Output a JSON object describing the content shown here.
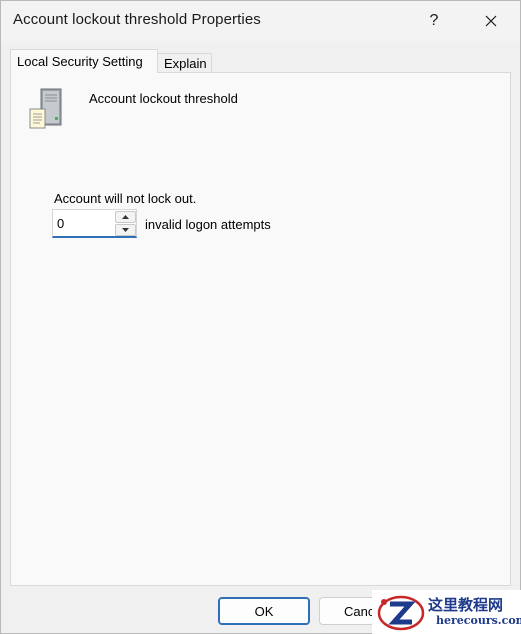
{
  "window": {
    "title": "Account lockout threshold Properties",
    "help_label": "?",
    "close_label": "✕"
  },
  "tabs": [
    {
      "label": "Local Security Setting",
      "active": true
    },
    {
      "label": "Explain",
      "active": false
    }
  ],
  "setting": {
    "icon": "server-icon",
    "policy_name": "Account lockout threshold",
    "status_text": "Account will not lock out.",
    "value": "0",
    "unit_label": "invalid logon attempts"
  },
  "buttons": {
    "ok_label": "OK",
    "cancel_label": "Canc"
  },
  "watermark": {
    "title": "这里教程网",
    "url": "herecours.com"
  },
  "colors": {
    "accent": "#2f6fb8",
    "dialog_bg": "#f0f0f0",
    "panel_bg": "#f9f9f9",
    "watermark_text": "#1e3a8a",
    "watermark_red": "#c62828"
  }
}
